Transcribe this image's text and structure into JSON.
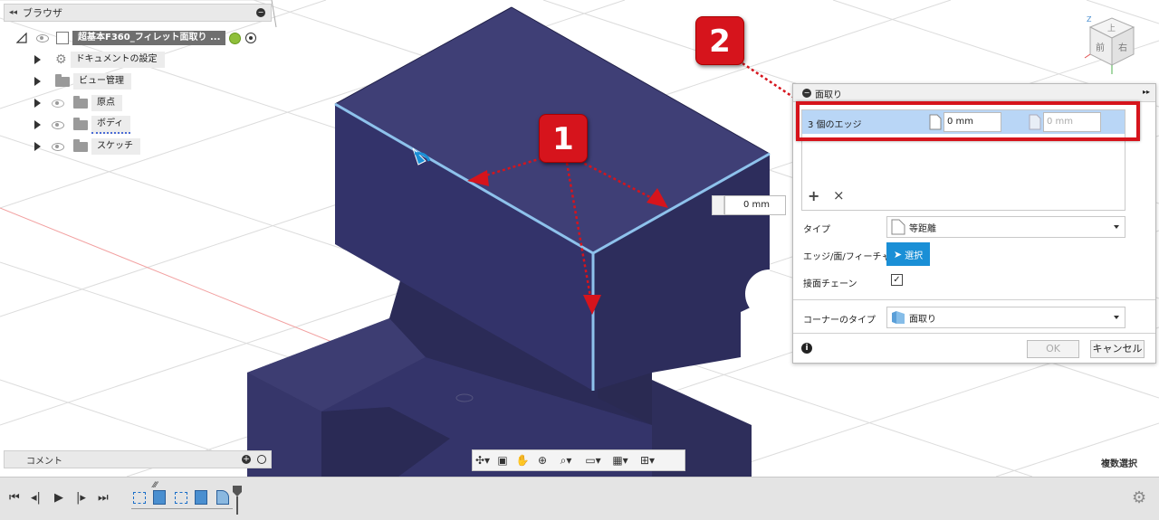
{
  "browser": {
    "title": "ブラウザ",
    "collapse_glyph": "◂◂",
    "root_name": "超基本F360_フィレット面取り ...",
    "items": [
      {
        "label": "ドキュメントの設定",
        "icon": "gear-icon"
      },
      {
        "label": "ビュー管理",
        "icon": "folder-icon"
      },
      {
        "label": "原点",
        "icon": "folder-icon"
      },
      {
        "label": "ボディ",
        "icon": "folder-icon"
      },
      {
        "label": "スケッチ",
        "icon": "folder-icon"
      }
    ]
  },
  "comment_panel": {
    "title": "コメント"
  },
  "viewcube": {
    "top_label": "上",
    "front_label": "前",
    "right_label": "右"
  },
  "canvas": {
    "inline_value": "0 mm"
  },
  "badges": {
    "one": "1",
    "two": "2"
  },
  "dialog": {
    "title": "面取り",
    "expand_glyph": "▸▸",
    "selection_row": {
      "label": "3 個のエッジ",
      "value1": "0 mm",
      "value2": "0 mm"
    },
    "add_glyph": "+",
    "remove_glyph": "×",
    "type_label": "タイプ",
    "type_value": "等距離",
    "edges_label": "エッジ/面/フィーチャ",
    "select_button": "選択",
    "tangent_chain_label": "接面チェーン",
    "tangent_chain_checked": true,
    "corner_type_label": "コーナーのタイプ",
    "corner_type_value": "面取り",
    "info_glyph": "i",
    "ok_label": "OK",
    "cancel_label": "キャンセル"
  },
  "status": {
    "multi_select": "複数選択"
  },
  "colors": {
    "body": "#3a3a69",
    "edge_highlight": "#8ec2ec",
    "badge_red": "#d6141c",
    "select_blue": "#1a8fd6",
    "row_highlight": "#b9d6f6"
  }
}
